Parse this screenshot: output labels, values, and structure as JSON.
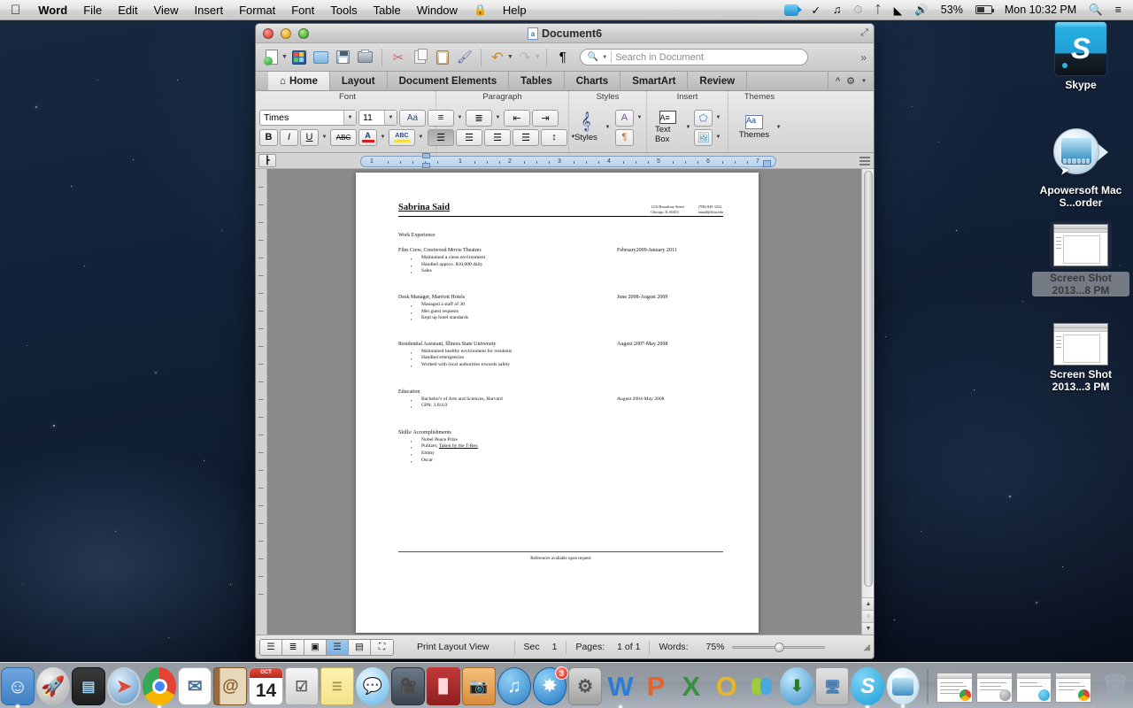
{
  "menubar": {
    "apple_icon": "apple-logo",
    "app_name": "Word",
    "items": [
      "File",
      "Edit",
      "View",
      "Insert",
      "Format",
      "Font",
      "Tools",
      "Table",
      "Window"
    ],
    "help": "Help",
    "status": {
      "battery_percent": "53%",
      "clock": "Mon 10:32 PM",
      "spotlight_icon": "search-icon",
      "notification_icon": "notification-center-icon",
      "volume_icon": "volume-icon",
      "wifi_icon": "wifi-icon",
      "bluetooth_icon": "bluetooth-icon",
      "timemachine_icon": "time-machine-icon",
      "audio_icon": "audio-waveform-icon",
      "checkmark_icon": "checkmark-shield-icon",
      "camera_icon": "screen-recorder-icon"
    }
  },
  "window": {
    "title": "Document6",
    "toolbar": {
      "buttons": [
        "new-document",
        "new-from-template",
        "open",
        "save",
        "print",
        "cut",
        "copy",
        "paste",
        "format-painter",
        "undo",
        "redo",
        "show-formatting-marks"
      ],
      "search_placeholder": "Search in Document",
      "overflow_label": "»"
    },
    "tabs": [
      {
        "label": "Home",
        "active": true,
        "icon": "home-icon"
      },
      {
        "label": "Layout",
        "active": false
      },
      {
        "label": "Document Elements",
        "active": false
      },
      {
        "label": "Tables",
        "active": false
      },
      {
        "label": "Charts",
        "active": false
      },
      {
        "label": "SmartArt",
        "active": false
      },
      {
        "label": "Review",
        "active": false
      }
    ],
    "ribbon": {
      "groups": [
        {
          "title": "Font"
        },
        {
          "title": "Paragraph"
        },
        {
          "title": "Styles"
        },
        {
          "title": "Insert"
        },
        {
          "title": "Themes"
        }
      ],
      "font": {
        "name": "Times",
        "size": "11",
        "bold": "B",
        "italic": "I",
        "underline": "U",
        "strikethrough": "ABC",
        "font_color": "A",
        "highlight": "ABC",
        "change_case": "Aa"
      },
      "styles_label": "Styles",
      "textbox_label": "Text Box",
      "themes_label": "Themes"
    },
    "ruler": {
      "numbers": [
        "1",
        "1",
        "2",
        "3",
        "4",
        "5",
        "6",
        "7"
      ]
    },
    "statusbar": {
      "view_label": "Print Layout View",
      "sec_label": "Sec",
      "sec_value": "1",
      "pages_label": "Pages:",
      "pages_value": "1 of 1",
      "words_label": "Words:",
      "zoom_value": "75%"
    }
  },
  "document": {
    "name": "Sabrina Said",
    "contact": {
      "address_line1": "1234 Broadway Street",
      "address_line2": "Chicago, IL 60453",
      "phone": "(708) 845-3232",
      "email": "smaid@ilstu.edu"
    },
    "section_work": "Work Experience",
    "jobs": [
      {
        "title": "Film Crew, Crestwood Movie Theatres",
        "dates": "February2009-January 2011",
        "bullets": [
          "Maintained a clean environment",
          "Handled approx. $10,000 daily",
          "Sales"
        ]
      },
      {
        "title": "Desk Manager, Marriott Hotels",
        "dates": "June 2008-August 2009",
        "bullets": [
          "Managed a staff of 30",
          "Met guest requests",
          "Kept up hotel standards"
        ]
      },
      {
        "title": "Residential Assistant, Illinois State University",
        "dates": "August 2007-May 2008",
        "bullets": [
          "Maintained healthy environment for residents",
          "Handled emergencies",
          "Worked with local authorities towards safety"
        ]
      }
    ],
    "section_education": "Education",
    "education": [
      {
        "text": "Bachelor's of Arts and Sciences, Harvard",
        "dates": "August 2004-May 2008"
      },
      {
        "text": "GPA: 3.8/4.0",
        "dates": ""
      }
    ],
    "section_skills": "Skills/ Accomplishments",
    "skills": [
      {
        "prefix": "Nobel Peace Prize",
        "underlined": ""
      },
      {
        "prefix": "Pulitzer, ",
        "underlined": "Taken by the T-Rex"
      },
      {
        "prefix": "Emmy",
        "underlined": ""
      },
      {
        "prefix": "Oscar",
        "underlined": ""
      }
    ],
    "footer": "References available upon request"
  },
  "desktop_icons": [
    {
      "name": "Skype",
      "type": "skype-drive",
      "selected": false
    },
    {
      "name": "Apowersoft Mac S...order",
      "type": "apowersoft",
      "selected": false
    },
    {
      "name": "Screen Shot 2013...8 PM",
      "type": "screenshot",
      "selected": true
    },
    {
      "name": "Screen Shot 2013...3 PM",
      "type": "screenshot",
      "selected": false
    }
  ],
  "dock": {
    "items": [
      {
        "name": "finder-icon",
        "running": true
      },
      {
        "name": "launchpad-icon",
        "running": false
      },
      {
        "name": "mission-control-icon",
        "running": false
      },
      {
        "name": "safari-icon",
        "running": false
      },
      {
        "name": "chrome-icon",
        "running": true
      },
      {
        "name": "mail-icon",
        "running": false
      },
      {
        "name": "contacts-icon",
        "running": false
      },
      {
        "name": "calendar-icon",
        "running": false,
        "date": "14",
        "month": "OCT"
      },
      {
        "name": "reminders-icon",
        "running": false
      },
      {
        "name": "notes-icon",
        "running": false
      },
      {
        "name": "messages-icon",
        "running": false
      },
      {
        "name": "facetime-icon",
        "running": false
      },
      {
        "name": "photo-booth-icon",
        "running": false
      },
      {
        "name": "iphoto-icon",
        "running": false
      },
      {
        "name": "itunes-icon",
        "running": false
      },
      {
        "name": "app-store-icon",
        "running": false,
        "badge": "3"
      },
      {
        "name": "system-preferences-icon",
        "running": false
      },
      {
        "name": "word-icon",
        "running": true,
        "letter": "W"
      },
      {
        "name": "powerpoint-icon",
        "running": false,
        "letter": "P"
      },
      {
        "name": "excel-icon",
        "running": false,
        "letter": "X"
      },
      {
        "name": "outlook-icon",
        "running": false,
        "letter": "O"
      },
      {
        "name": "messenger-icon",
        "running": false
      },
      {
        "name": "download-icon",
        "running": false
      },
      {
        "name": "remote-desktop-icon",
        "running": false
      },
      {
        "name": "skype-dock-icon",
        "running": true,
        "letter": "S"
      },
      {
        "name": "apowersoft-dock-icon",
        "running": true
      }
    ],
    "minimized": [
      {
        "name": "minimized-window-chrome"
      },
      {
        "name": "minimized-window-preferences"
      },
      {
        "name": "minimized-window-skype"
      },
      {
        "name": "minimized-window-chrome-2"
      }
    ],
    "trash": "trash-icon"
  }
}
